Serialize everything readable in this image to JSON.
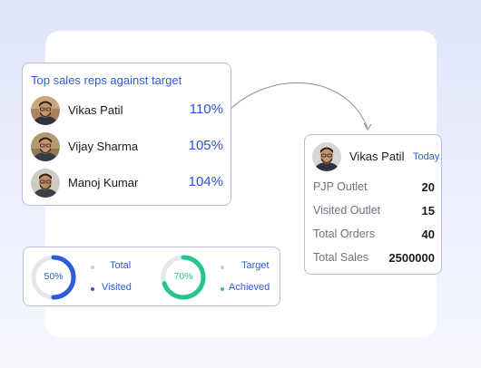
{
  "top_reps": {
    "title": "Top sales reps against target",
    "reps": [
      {
        "name": "Vikas Patil",
        "percent": "110%"
      },
      {
        "name": "Vijay Sharma",
        "percent": "105%"
      },
      {
        "name": "Manoj Kumar",
        "percent": "104%"
      }
    ]
  },
  "rep_detail": {
    "name": "Vikas Patil",
    "period": "Today",
    "rows": [
      {
        "label": "PJP Outlet",
        "value": "20"
      },
      {
        "label": "Visited Outlet",
        "value": "15"
      },
      {
        "label": "Total Orders",
        "value": "40"
      },
      {
        "label": "Total Sales",
        "value": "2500000"
      }
    ]
  },
  "stats": {
    "visited": {
      "percent_label": "50%",
      "fraction": 0.5,
      "color": "#2f5bd8",
      "legend": [
        "Total",
        "Visited"
      ]
    },
    "achieved": {
      "percent_label": "70%",
      "fraction": 0.7,
      "color": "#27c48f",
      "legend": [
        "Target",
        "Achieved"
      ]
    }
  },
  "colors": {
    "accent": "#2f5bd8",
    "green": "#27c48f",
    "track": "#e6e7ec"
  }
}
